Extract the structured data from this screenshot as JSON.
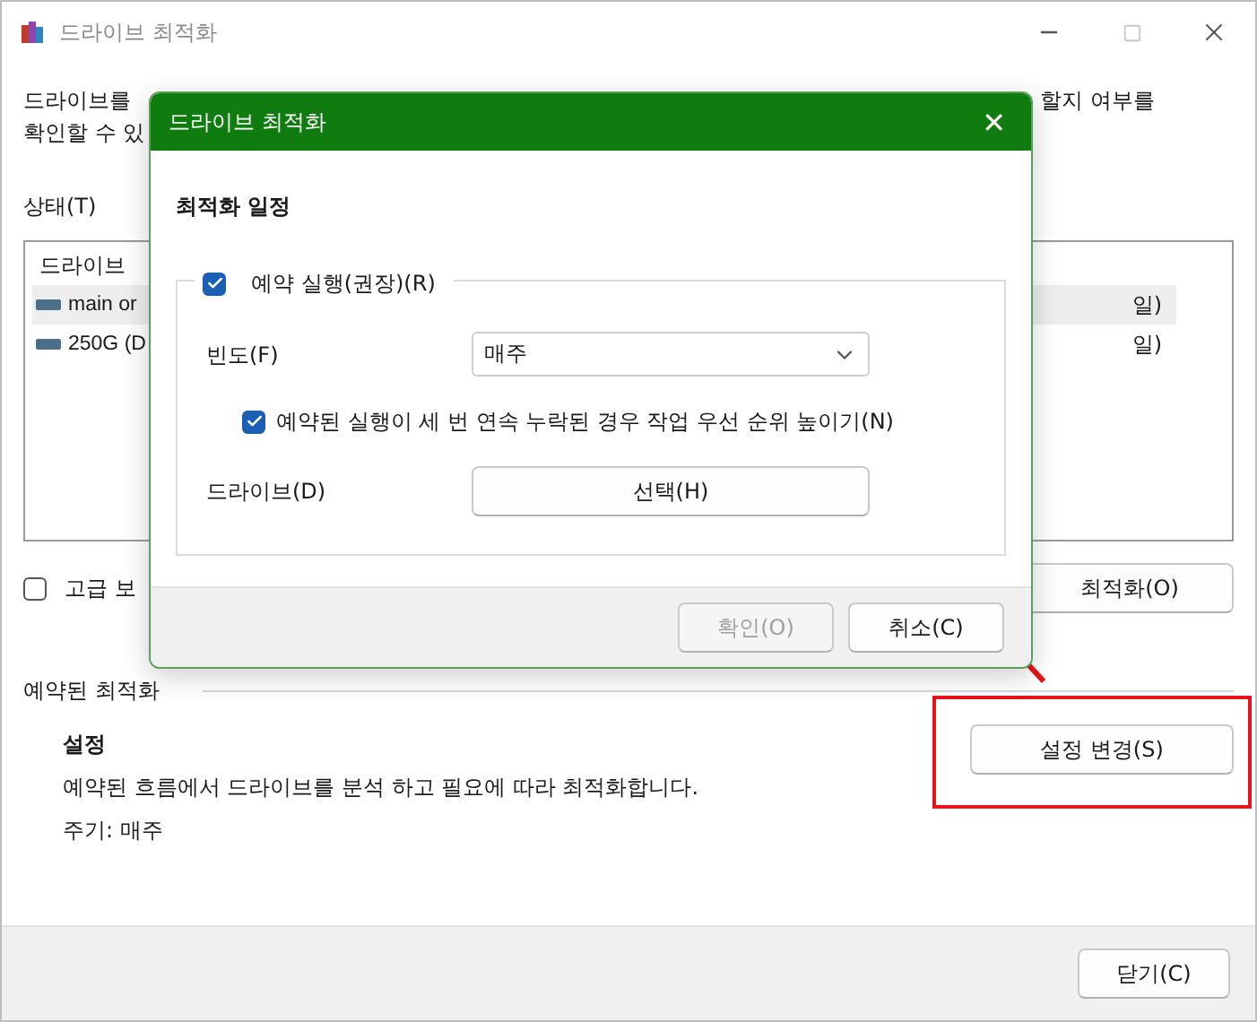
{
  "main_window": {
    "title": "드라이브 최적화",
    "description": {
      "line_1_start": "드라이브를",
      "line_1_end": "할지 여부를",
      "line_2_start": "확인할 수 있"
    },
    "status_label": "상태(T)",
    "drive_list": {
      "column_1": "드라이브",
      "rows": [
        {
          "column_1": "main or",
          "column_3": "일)",
          "selected": true
        },
        {
          "column_1": "250G (D",
          "column_3": "일)",
          "selected": false
        }
      ]
    },
    "advanced_view": {
      "label": "고급 보",
      "checked": false
    },
    "optimize_button": "최적화(O)",
    "scheduled": {
      "heading": "예약된 최적화",
      "settings_title": "설정",
      "settings_text": "예약된 흐름에서 드라이브를 분석 하고 필요에 따라 최적화합니다.",
      "frequency_text": "주기: 매주",
      "change_button": "설정 변경(S)"
    },
    "close_button": "닫기(C)"
  },
  "dialog": {
    "title": "드라이브 최적화",
    "close_glyph": "✕",
    "heading": "최적화 일정",
    "run_on_schedule": {
      "label": "예약 실행(권장)(R)",
      "checked": true
    },
    "frequency": {
      "label": "빈도(F)",
      "value": "매주"
    },
    "raise_priority": {
      "label": "예약된 실행이 세 번 연속 누락된 경우 작업 우선 순위 높이기(N)",
      "checked": true
    },
    "drives": {
      "label": "드라이브(D)",
      "button": "선택(H)"
    },
    "buttons": [
      {
        "label": "확인(O)",
        "disabled": true
      },
      {
        "label": "취소(C)",
        "disabled": false
      }
    ]
  }
}
